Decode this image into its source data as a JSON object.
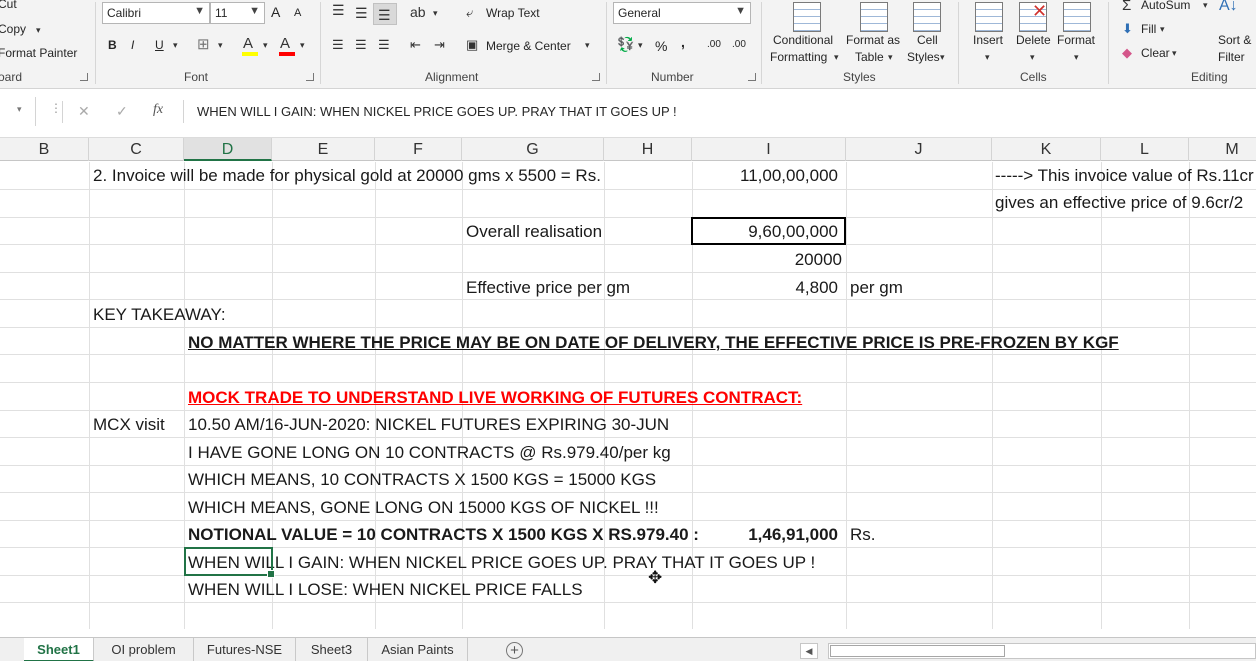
{
  "ribbon": {
    "clipboard": {
      "cut": "Cut",
      "copy": "Copy",
      "format_painter": "Format Painter",
      "group": "oard"
    },
    "font": {
      "name": "Calibri",
      "size": "11",
      "bold": "B",
      "italic": "I",
      "underline": "U",
      "grow": "A",
      "shrink": "A",
      "fill_glyph": "A",
      "color_glyph": "A",
      "group": "Font"
    },
    "alignment": {
      "wrap_text": "Wrap Text",
      "merge_center": "Merge & Center",
      "group": "Alignment"
    },
    "number": {
      "format": "General",
      "percent": "%",
      "comma": ",",
      "inc_decimal": ".00",
      "dec_decimal": ".00",
      "group": "Number"
    },
    "styles": {
      "conditional_1": "Conditional",
      "conditional_2": "Formatting",
      "format_table_1": "Format as",
      "format_table_2": "Table",
      "cell_styles_1": "Cell",
      "cell_styles_2": "Styles",
      "group": "Styles"
    },
    "cells": {
      "insert": "Insert",
      "delete": "Delete",
      "format": "Format",
      "group": "Cells"
    },
    "editing": {
      "autosum": "AutoSum",
      "fill": "Fill",
      "clear": "Clear",
      "sort_1": "Sort &",
      "sort_2": "Filter",
      "group": "Editing"
    }
  },
  "formula_bar": {
    "cancel": "✕",
    "enter": "✓",
    "fx": "fx",
    "content": "WHEN WILL I GAIN: WHEN NICKEL PRICE GOES UP. PRAY THAT IT GOES UP !"
  },
  "columns": [
    "B",
    "C",
    "D",
    "E",
    "F",
    "G",
    "H",
    "I",
    "J",
    "K",
    "L",
    "M"
  ],
  "selected_column": "D",
  "cells": {
    "r1_c": "2. Invoice will be made for physical gold at 20000 gms x 5500 = Rs.",
    "r1_i": "11,00,00,000",
    "r1_k": "-----> This invoice value of Rs.11cr",
    "r2_k": "gives an effective price of 9.6cr/2",
    "r3_g": "Overall realisation",
    "r3_i": "9,60,00,000",
    "r4_i": "20000",
    "r5_g": "Effective price per gm",
    "r5_i": "4,800",
    "r5_j": "per gm",
    "r6_c": "KEY TAKEAWAY:",
    "r7_d": "NO MATTER WHERE THE PRICE MAY BE ON DATE OF DELIVERY, THE EFFECTIVE PRICE IS PRE-FROZEN BY KGF",
    "r9_d": "MOCK TRADE TO UNDERSTAND LIVE WORKING OF FUTURES CONTRACT:",
    "r10_c": "MCX visit",
    "r10_d": "10.50 AM/16-JUN-2020: NICKEL FUTURES EXPIRING 30-JUN",
    "r11_d": "I HAVE GONE LONG ON 10 CONTRACTS @ Rs.979.40/per kg",
    "r12_d": "WHICH MEANS, 10 CONTRACTS X 1500 KGS = 15000 KGS",
    "r13_d": "WHICH MEANS, GONE LONG ON 15000 KGS OF NICKEL !!!",
    "r14_d": "NOTIONAL VALUE = 10 CONTRACTS X 1500 KGS X RS.979.40 :",
    "r14_i": "1,46,91,000",
    "r14_j": "Rs.",
    "r15_d": "WHEN WILL I GAIN: WHEN NICKEL PRICE GOES UP. PRAY THAT IT GOES UP !",
    "r16_d": "WHEN WILL I LOSE: WHEN NICKEL PRICE FALLS"
  },
  "sheet_tabs": [
    "Sheet1",
    "OI problem",
    "Futures-NSE",
    "Sheet3",
    "Asian Paints"
  ],
  "active_sheet": "Sheet1",
  "colors": {
    "accent": "#217346",
    "red_text": "#ff0000"
  }
}
